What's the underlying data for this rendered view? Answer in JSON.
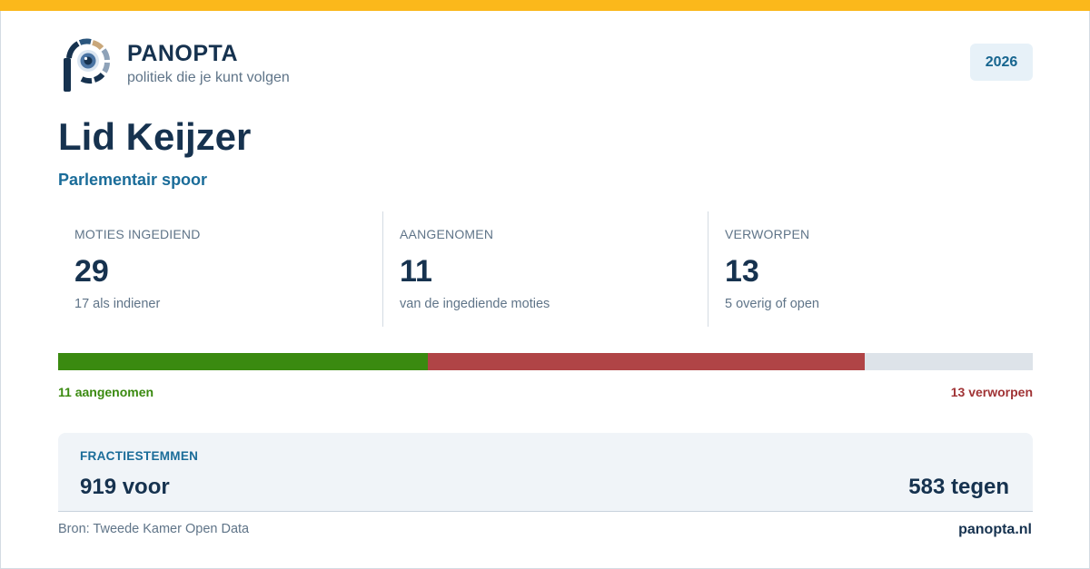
{
  "brand": {
    "name": "PANOPTA",
    "tagline": "politiek die je kunt volgen",
    "accent_color": "#fbb81b",
    "logo_icon": "eye-p-logo-icon"
  },
  "year_badge": "2026",
  "title": "Lid Keijzer",
  "subtitle": "Parlementair spoor",
  "stats": [
    {
      "label": "MOTIES INGEDIEND",
      "value": "29",
      "note": "17 als indiener"
    },
    {
      "label": "AANGENOMEN",
      "value": "11",
      "note": "van de ingediende moties"
    },
    {
      "label": "VERWORPEN",
      "value": "13",
      "note": "5 overig of open"
    }
  ],
  "bar": {
    "total": 29,
    "accepted": 11,
    "rejected": 13,
    "accepted_color": "#3a8a10",
    "rejected_color": "#b04446",
    "other_color": "#dde3e9",
    "accepted_label": "11 aangenomen",
    "rejected_label": "13 verworpen"
  },
  "votes": {
    "label": "FRACTIESTEMMEN",
    "for": "919 voor",
    "against": "583 tegen"
  },
  "footer": {
    "source": "Bron: Tweede Kamer Open Data",
    "site": "panopta.nl"
  }
}
